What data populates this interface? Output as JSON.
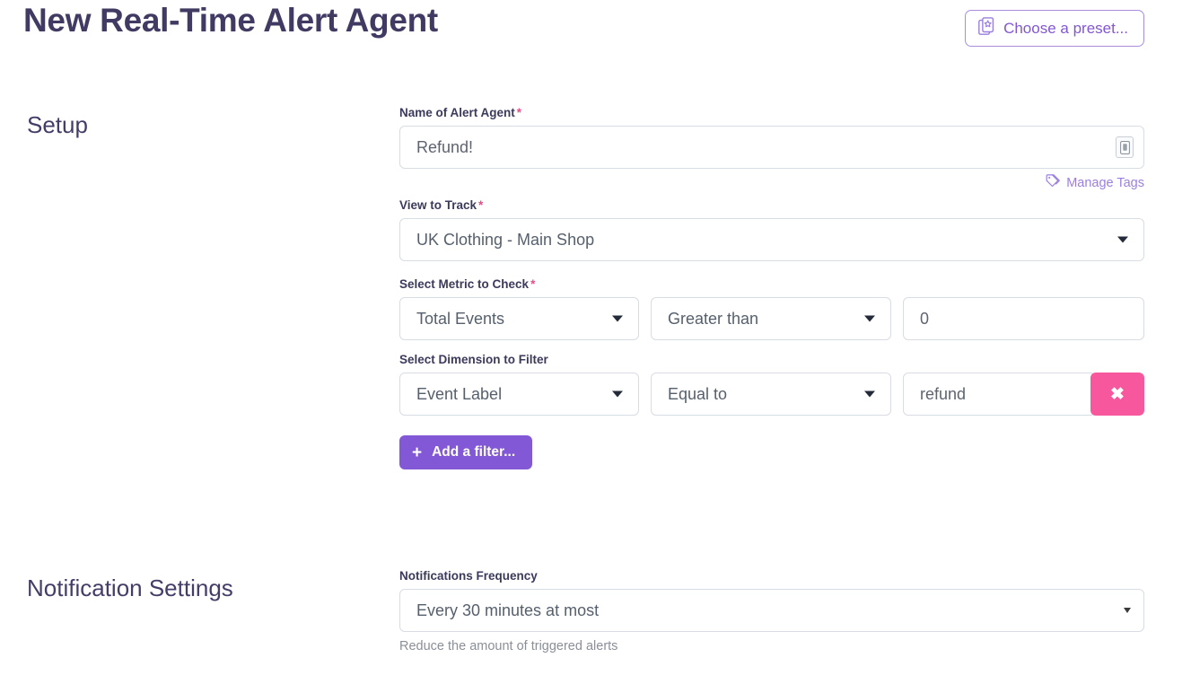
{
  "header": {
    "title": "New Real-Time Alert Agent",
    "preset_button_label": "Choose a preset...",
    "preset_icon": "preset-pages-star-icon"
  },
  "sections": [
    {
      "key": "setup",
      "title": "Setup"
    },
    {
      "key": "notifications",
      "title": "Notification Settings"
    }
  ],
  "setup": {
    "name_field": {
      "label": "Name of Alert Agent",
      "required_marker": "*",
      "value": "Refund!",
      "placeholder": "Refund!",
      "tag_icon": "tag-badge-icon"
    },
    "manage_tags": {
      "label": "Manage Tags",
      "icon": "tags-icon"
    },
    "view_field": {
      "label": "View to Track",
      "required_marker": "*",
      "value": "UK Clothing - Main Shop",
      "caret_icon": "chevron-down-icon"
    },
    "metric_field": {
      "label": "Select Metric to Check",
      "required_marker": "*",
      "metric_value": "Total Events",
      "comparator_value": "Greater than",
      "threshold_value": "0",
      "threshold_placeholder": "0",
      "caret_icon": "chevron-down-icon"
    },
    "dimension_field": {
      "label": "Select Dimension to Filter",
      "dimension_value": "Event Label",
      "comparator_value": "Equal to",
      "filter_value": "refund",
      "filter_placeholder": "refund",
      "remove_label": "✖",
      "remove_icon": "close-x-icon",
      "caret_icon": "chevron-down-icon"
    },
    "add_filter_button": {
      "label": "Add a filter...",
      "plus": "+",
      "icon": "plus-icon"
    }
  },
  "notifications": {
    "frequency_field": {
      "label": "Notifications Frequency",
      "value": "Every 30 minutes at most",
      "help_text": "Reduce the amount of triggered alerts",
      "caret_icon": "chevron-down-icon"
    }
  },
  "colors": {
    "title": "#413a63",
    "accent_purple": "#8358d6",
    "link_purple": "#9b7fe0",
    "required_pink": "#ef4b87",
    "remove_pink": "#f7579c",
    "border": "#d7dde3",
    "text": "#56606d",
    "help_text": "#8a8f98"
  }
}
